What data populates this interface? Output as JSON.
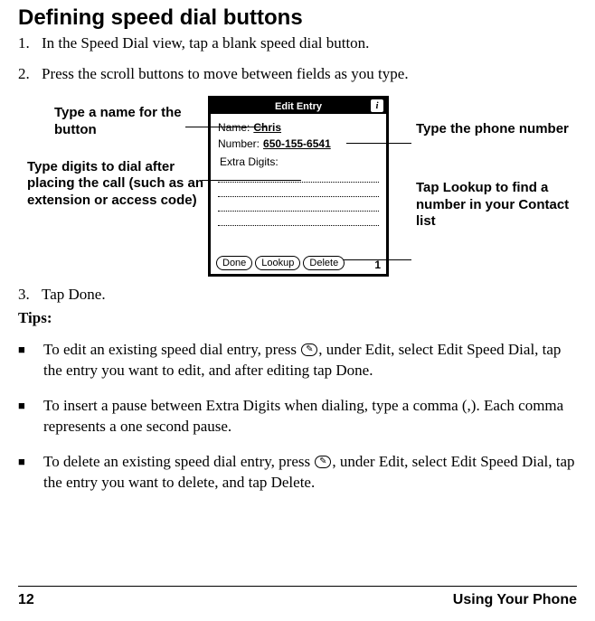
{
  "heading": "Defining speed dial buttons",
  "steps": {
    "s1_num": "1.",
    "s1_text": "In the Speed Dial view, tap a blank speed dial button.",
    "s2_num": "2.",
    "s2_text": "Press the scroll buttons to move between fields as you type.",
    "s3_num": "3.",
    "s3_text": "Tap Done."
  },
  "callouts": {
    "left1": "Type a name for the button",
    "left2": "Type digits to dial after placing the call (such as an extension or access code)",
    "right1": "Type the phone number",
    "right2": "Tap Lookup to find a number in your Contact list"
  },
  "device": {
    "title": "Edit Entry",
    "info": "i",
    "name_label": "Name:",
    "name_value": "Chris",
    "number_label": "Number:",
    "number_value": "650-155-6541",
    "extra_label": "Extra Digits:",
    "btn_done": "Done",
    "btn_lookup": "Lookup",
    "btn_delete": "Delete",
    "page": "1"
  },
  "tips_label": "Tips:",
  "tips": {
    "t1a": "To edit an existing speed dial entry, press ",
    "t1b": ", under Edit, select Edit Speed Dial, tap the entry you want to edit, and after editing tap Done.",
    "t2": "To insert a pause between Extra Digits when dialing, type a comma (,). Each comma represents a one second pause.",
    "t3a": "To delete an existing speed dial entry, press ",
    "t3b": ", under Edit, select Edit Speed Dial, tap the entry you want to delete, and tap Delete."
  },
  "footer": {
    "page": "12",
    "section": "Using Your Phone"
  },
  "icon_glyph": "✎"
}
